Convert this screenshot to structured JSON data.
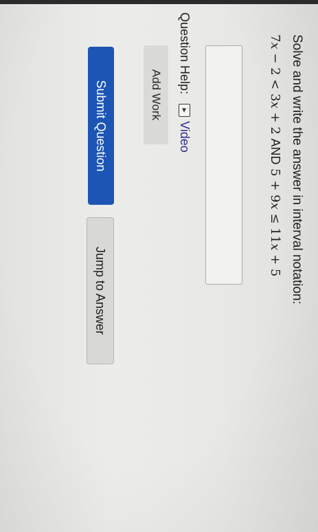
{
  "question": {
    "prompt": "Solve and write the answer in interval notation:",
    "math": {
      "a_coef": "7",
      "a_var": "x",
      "op1": " − 2 < ",
      "b_coef": "3",
      "b_var": "x",
      "op2": " + 2 ",
      "and_label": "AND",
      "c_const": " 5 + 9",
      "c_var": "x",
      "op3": " ≤ 11",
      "d_var": "x",
      "op4": " + 5"
    },
    "answer_value": ""
  },
  "help": {
    "label": "Question Help:",
    "video_icon": "play-triangle-icon",
    "video_label": "Video"
  },
  "buttons": {
    "add_work": "Add Work",
    "submit": "Submit Question",
    "jump": "Jump to Answer"
  },
  "colors": {
    "submit_bg": "#1c55b3",
    "link": "#2f2a8f"
  }
}
